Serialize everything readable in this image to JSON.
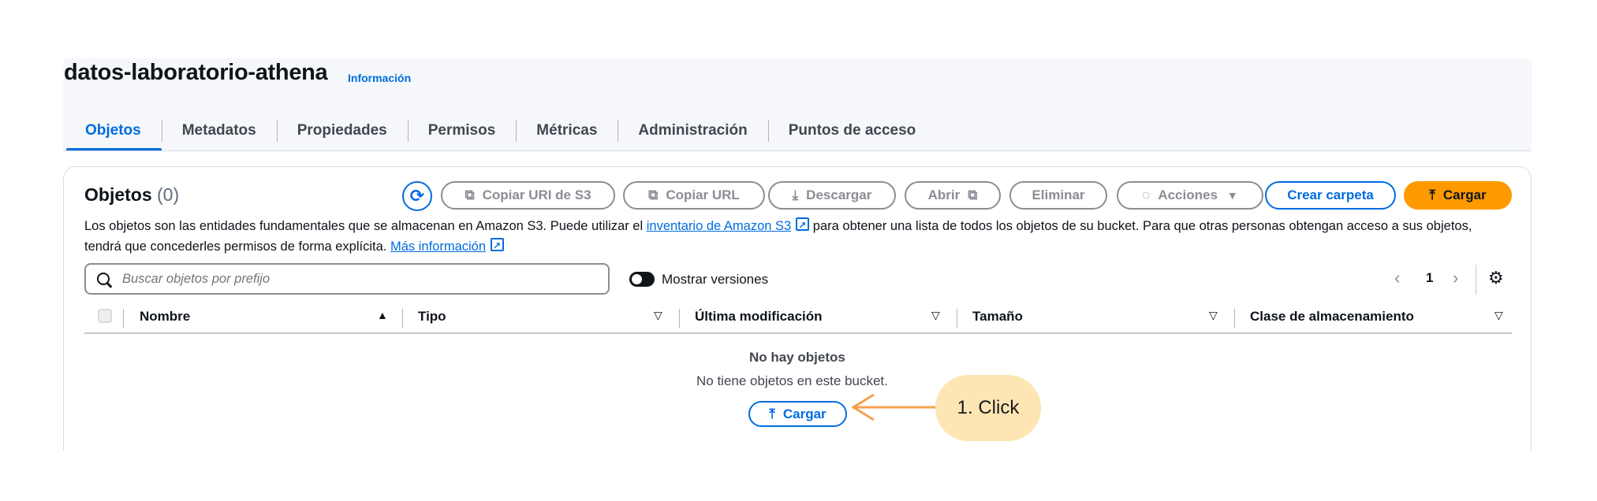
{
  "bucket": {
    "name": "datos-laboratorio-athena",
    "info_link": "Información"
  },
  "tabs": [
    {
      "label": "Objetos"
    },
    {
      "label": "Metadatos"
    },
    {
      "label": "Propiedades"
    },
    {
      "label": "Permisos"
    },
    {
      "label": "Métricas"
    },
    {
      "label": "Administración"
    },
    {
      "label": "Puntos de acceso"
    }
  ],
  "objects": {
    "title": "Objetos",
    "count": "(0)",
    "description_part1": "Los objetos son las entidades fundamentales que se almacenan en Amazon S3. Puede utilizar el",
    "inventory_link": "inventario de Amazon S3",
    "description_part2": "para obtener una lista de todos los objetos de su bucket. Para que otras personas obtengan acceso a sus objetos, tendrá que concederles permisos de forma explícita.",
    "more_info_link": "Más información"
  },
  "toolbar": {
    "copy_uri": "Copiar URI de S3",
    "copy_url": "Copiar URL",
    "download": "Descargar",
    "open": "Abrir",
    "delete": "Eliminar",
    "actions": "Acciones",
    "create_folder": "Crear carpeta",
    "upload": "Cargar"
  },
  "search": {
    "placeholder": "Buscar objetos por prefijo",
    "value": ""
  },
  "show_versions": {
    "label": "Mostrar versiones",
    "enabled": false
  },
  "pagination": {
    "current_page": "1"
  },
  "table": {
    "columns": [
      "Nombre",
      "Tipo",
      "Última modificación",
      "Tamaño",
      "Clase de almacenamiento"
    ]
  },
  "empty_state": {
    "title": "No hay objetos",
    "subtitle": "No tiene objetos en este bucket.",
    "upload_label": "Cargar"
  },
  "annotation": {
    "callout": "1. Click",
    "color": "#f5a04d"
  }
}
